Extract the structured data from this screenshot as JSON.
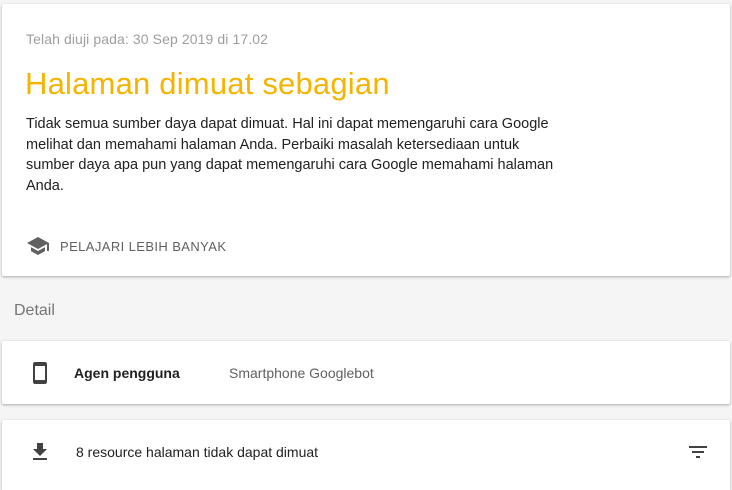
{
  "summary": {
    "tested_text": "Telah diuji pada: 30 Sep 2019 di 17.02",
    "status_title": "Halaman dimuat sebagian",
    "status_color": "#f4b400",
    "description": "Tidak semua sumber daya dapat dimuat. Hal ini dapat memengaruhi cara Google melihat dan memahami halaman Anda. Perbaiki masalah ketersediaan untuk sumber daya apa pun yang dapat memengaruhi cara Google memahami halaman Anda.",
    "learn_more_icon": "school-icon",
    "learn_more_label": "PELAJARI LEBIH BANYAK"
  },
  "details": {
    "heading": "Detail",
    "user_agent": {
      "icon": "smartphone-icon",
      "label": "Agen pengguna",
      "value": "Smartphone Googlebot"
    },
    "resources": {
      "icon": "download-icon",
      "text": "8 resource halaman tidak dapat dimuat",
      "filter_icon": "filter-icon"
    }
  }
}
